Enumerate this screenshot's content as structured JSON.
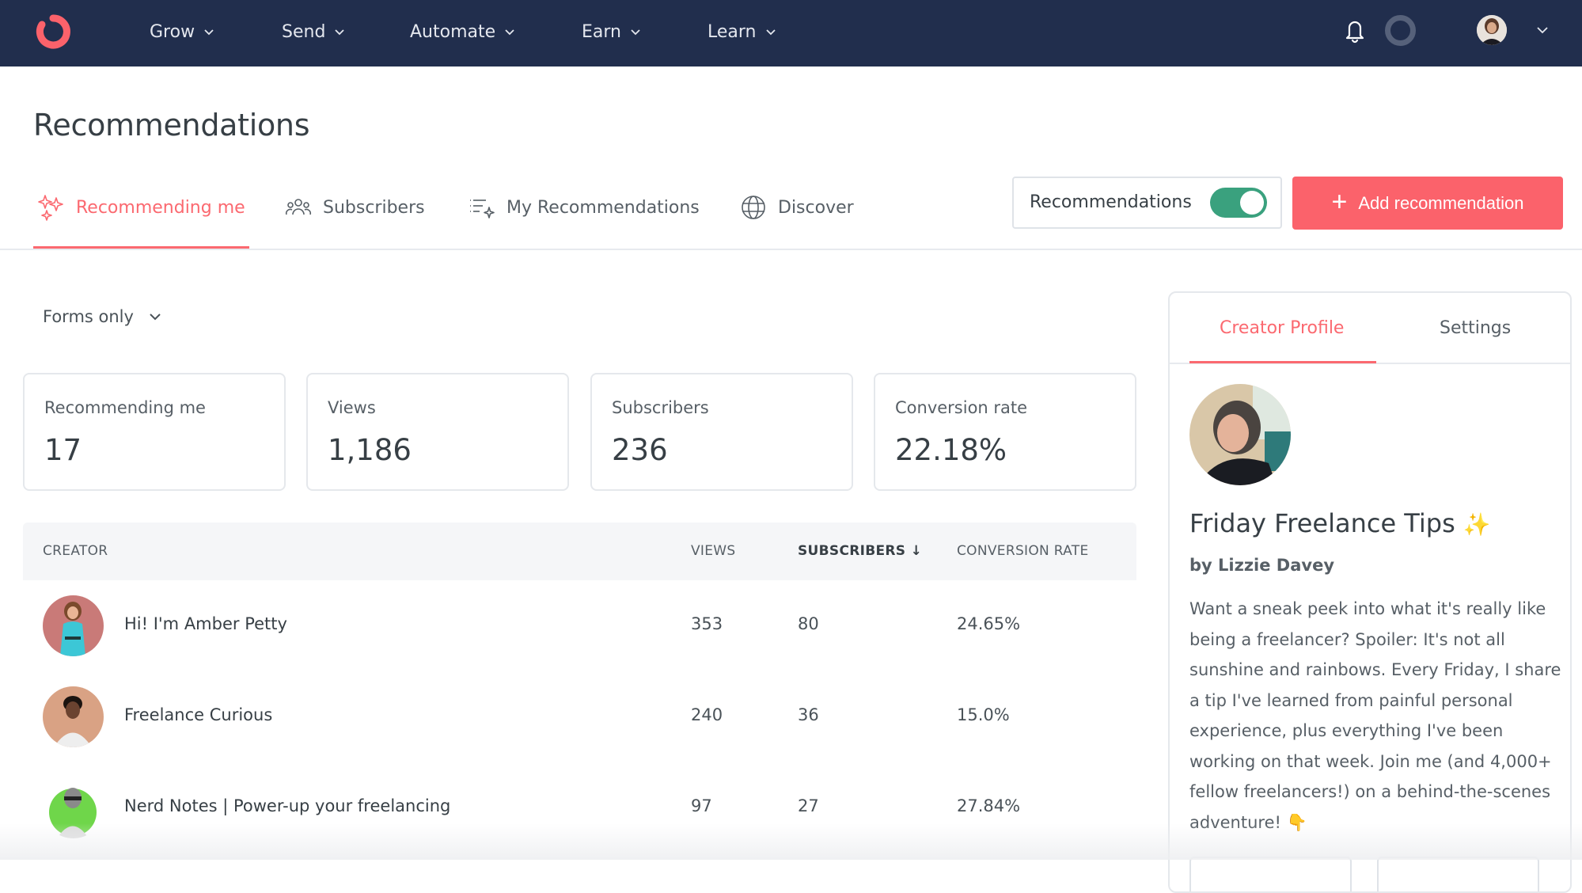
{
  "nav": {
    "logo": "convertkit-logo-icon",
    "items": [
      {
        "label": "Grow"
      },
      {
        "label": "Send"
      },
      {
        "label": "Automate"
      },
      {
        "label": "Earn"
      },
      {
        "label": "Learn"
      }
    ],
    "icons": [
      "bell-icon",
      "loading-ring-icon",
      "user-avatar",
      "chevron-down-icon"
    ]
  },
  "header": {
    "title": "Recommendations",
    "tabs": [
      {
        "label": "Recommending me",
        "icon": "sparkles-icon",
        "active": true
      },
      {
        "label": "Subscribers",
        "icon": "users-icon",
        "active": false
      },
      {
        "label": "My Recommendations",
        "icon": "list-sparkle-icon",
        "active": false
      },
      {
        "label": "Discover",
        "icon": "globe-icon",
        "active": false
      }
    ],
    "toggle": {
      "label": "Recommendations",
      "on": true
    },
    "add_button": {
      "label": "Add recommendation",
      "icon": "plus-icon"
    }
  },
  "filter": {
    "selected": "Forms only"
  },
  "stats": [
    {
      "label": "Recommending me",
      "value": "17"
    },
    {
      "label": "Views",
      "value": "1,186"
    },
    {
      "label": "Subscribers",
      "value": "236"
    },
    {
      "label": "Conversion rate",
      "value": "22.18%"
    }
  ],
  "table": {
    "columns": [
      "CREATOR",
      "VIEWS",
      "SUBSCRIBERS",
      "CONVERSION RATE"
    ],
    "sort_indicator": "↓",
    "rows": [
      {
        "creator": "Hi! I'm Amber Petty",
        "views": "353",
        "subscribers": "80",
        "conversion_rate": "24.65%"
      },
      {
        "creator": "Freelance Curious",
        "views": "240",
        "subscribers": "36",
        "conversion_rate": "15.0%"
      },
      {
        "creator": "Nerd Notes | Power-up your freelancing",
        "views": "97",
        "subscribers": "27",
        "conversion_rate": "27.84%"
      }
    ]
  },
  "panel": {
    "tabs": [
      {
        "label": "Creator Profile",
        "active": true
      },
      {
        "label": "Settings",
        "active": false
      }
    ],
    "profile": {
      "title": "Friday Freelance Tips",
      "title_emoji": "✨",
      "author": "by Lizzie Davey",
      "description": "Want a sneak peek into what it's really like being a freelancer? Spoiler: It's not all sunshine and rainbows. Every Friday, I share a tip I've learned from painful personal experience, plus everything I've been working on that week. Join me (and 4,000+ fellow freelancers!) on a behind-the-scenes adventure! 👇"
    }
  },
  "colors": {
    "nav_bg": "#212e4d",
    "accent": "#fb6970",
    "toggle_on": "#3aa17e",
    "text_primary": "#373f45",
    "text_secondary": "#575f66"
  }
}
